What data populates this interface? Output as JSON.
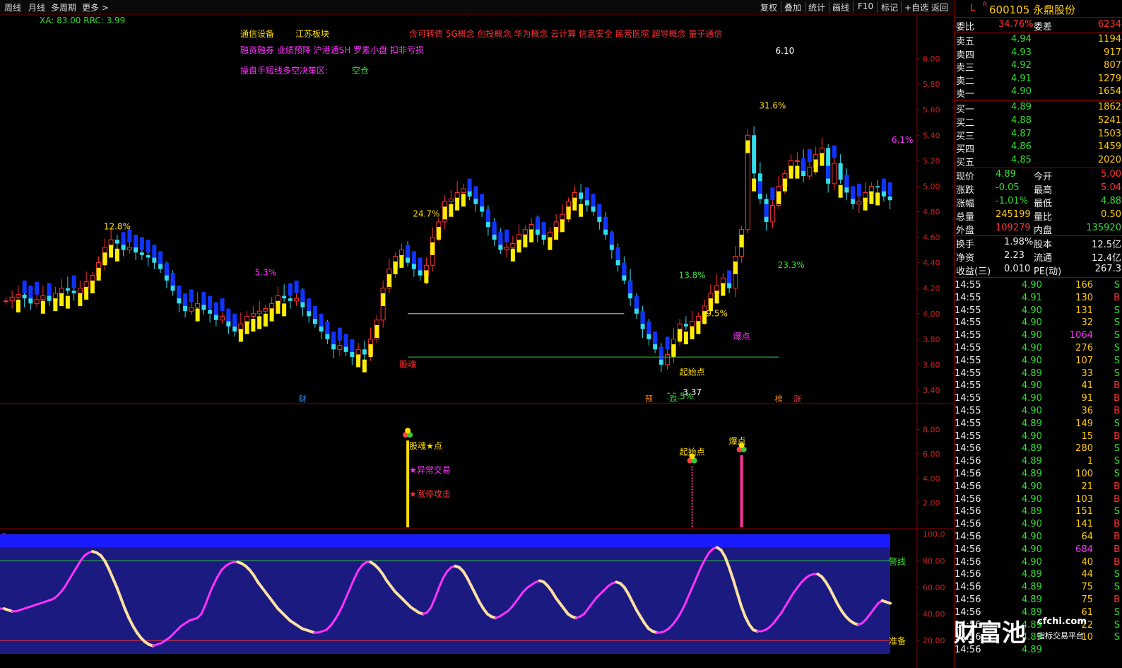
{
  "toolbar": {
    "left": [
      "周线",
      "月线",
      "多周期",
      "更多 >"
    ],
    "right": [
      "复权",
      "叠加",
      "统计",
      "画线",
      "F10",
      "标记",
      "+自选",
      "返回"
    ]
  },
  "stock": {
    "flag": "L",
    "flag_sup": "R",
    "code_name": "600105 永鼎股份"
  },
  "quote": {
    "ratio": {
      "label": "委比",
      "value": "34.76%",
      "label2": "委差",
      "value2": "6234"
    },
    "asks": [
      {
        "label": "卖五",
        "price": "4.94",
        "vol": "1194"
      },
      {
        "label": "卖四",
        "price": "4.93",
        "vol": "917"
      },
      {
        "label": "卖三",
        "price": "4.92",
        "vol": "807"
      },
      {
        "label": "卖二",
        "price": "4.91",
        "vol": "1279"
      },
      {
        "label": "卖一",
        "price": "4.90",
        "vol": "1654"
      }
    ],
    "bids": [
      {
        "label": "买一",
        "price": "4.89",
        "vol": "1862"
      },
      {
        "label": "买二",
        "price": "4.88",
        "vol": "5241"
      },
      {
        "label": "买三",
        "price": "4.87",
        "vol": "1503"
      },
      {
        "label": "买四",
        "price": "4.86",
        "vol": "1459"
      },
      {
        "label": "买五",
        "price": "4.85",
        "vol": "2020"
      }
    ],
    "stats": [
      {
        "l1": "现价",
        "v1": "4.89",
        "c1": "green",
        "l2": "今开",
        "v2": "5.00",
        "c2": "red"
      },
      {
        "l1": "涨跌",
        "v1": "-0.05",
        "c1": "green",
        "l2": "最高",
        "v2": "5.04",
        "c2": "red"
      },
      {
        "l1": "涨幅",
        "v1": "-1.01%",
        "c1": "green",
        "l2": "最低",
        "v2": "4.88",
        "c2": "green"
      },
      {
        "l1": "总量",
        "v1": "245199",
        "c1": "yellow",
        "l2": "量比",
        "v2": "0.50",
        "c2": "yellow"
      },
      {
        "l1": "外盘",
        "v1": "109279",
        "c1": "red",
        "l2": "内盘",
        "v2": "135920",
        "c2": "green"
      }
    ],
    "stats2": [
      {
        "l1": "换手",
        "v1": "1.98%",
        "l2": "股本",
        "v2": "12.5亿"
      },
      {
        "l1": "净资",
        "v1": "2.23",
        "l2": "流通",
        "v2": "12.4亿"
      },
      {
        "l1": "收益(三)",
        "v1": "0.010",
        "l2": "PE(动)",
        "v2": "267.3"
      }
    ]
  },
  "ticks": [
    {
      "t": "14:55",
      "p": "4.90",
      "v": "166",
      "s": "S"
    },
    {
      "t": "14:55",
      "p": "4.91",
      "v": "130",
      "s": "B"
    },
    {
      "t": "14:55",
      "p": "4.90",
      "v": "131",
      "s": "S"
    },
    {
      "t": "14:55",
      "p": "4.90",
      "v": "32",
      "s": "S"
    },
    {
      "t": "14:55",
      "p": "4.90",
      "v": "1064",
      "s": "S"
    },
    {
      "t": "14:55",
      "p": "4.90",
      "v": "276",
      "s": "S"
    },
    {
      "t": "14:55",
      "p": "4.90",
      "v": "107",
      "s": "S"
    },
    {
      "t": "14:55",
      "p": "4.89",
      "v": "33",
      "s": "S"
    },
    {
      "t": "14:55",
      "p": "4.90",
      "v": "41",
      "s": "B"
    },
    {
      "t": "14:55",
      "p": "4.90",
      "v": "91",
      "s": "B"
    },
    {
      "t": "14:55",
      "p": "4.90",
      "v": "36",
      "s": "B"
    },
    {
      "t": "14:55",
      "p": "4.89",
      "v": "149",
      "s": "S"
    },
    {
      "t": "14:55",
      "p": "4.90",
      "v": "15",
      "s": "B"
    },
    {
      "t": "14:56",
      "p": "4.89",
      "v": "280",
      "s": "S"
    },
    {
      "t": "14:56",
      "p": "4.89",
      "v": "1",
      "s": "S"
    },
    {
      "t": "14:56",
      "p": "4.89",
      "v": "100",
      "s": "S"
    },
    {
      "t": "14:56",
      "p": "4.90",
      "v": "21",
      "s": "B"
    },
    {
      "t": "14:56",
      "p": "4.90",
      "v": "103",
      "s": "B"
    },
    {
      "t": "14:56",
      "p": "4.89",
      "v": "151",
      "s": "S"
    },
    {
      "t": "14:56",
      "p": "4.90",
      "v": "141",
      "s": "B"
    },
    {
      "t": "14:56",
      "p": "4.90",
      "v": "64",
      "s": "B"
    },
    {
      "t": "14:56",
      "p": "4.90",
      "v": "684",
      "s": "B"
    },
    {
      "t": "14:56",
      "p": "4.90",
      "v": "40",
      "s": "B"
    },
    {
      "t": "14:56",
      "p": "4.89",
      "v": "44",
      "s": "S"
    },
    {
      "t": "14:56",
      "p": "4.89",
      "v": "75",
      "s": "S"
    },
    {
      "t": "14:56",
      "p": "4.89",
      "v": "75",
      "s": "B"
    },
    {
      "t": "14:56",
      "p": "4.89",
      "v": "61",
      "s": "S"
    },
    {
      "t": "14:56",
      "p": "4.89",
      "v": "22",
      "s": "S"
    },
    {
      "t": "14:56",
      "p": "4.89",
      "v": "10",
      "s": "S"
    },
    {
      "t": "14:56",
      "p": "4.89",
      "v": "",
      "s": ""
    }
  ],
  "watermark": {
    "big": "财富池",
    "url": "cfchi.com",
    "sub": "指标交易平台"
  },
  "chart_data": [
    {
      "type": "candlestick",
      "panel": "main",
      "info": "XA: 83.00  RRC: 3.99",
      "tags_line1": {
        "industry": "通信设备",
        "region": "江苏板块",
        "concepts": "含可转债 5G概念 创投概念 华为概念 云计算 信息安全 民营医院 超导概念 量子通信"
      },
      "tags_line2": "融资融券 业绩预降 沪港通SH 罗素小盘 扣非亏损",
      "strategy": {
        "label": "操盘手短线多空决策区:",
        "value": "空仓"
      },
      "y_ticks": [
        "6.00",
        "5.80",
        "5.60",
        "5.40",
        "5.20",
        "5.00",
        "4.80",
        "4.60",
        "4.40",
        "4.20",
        "4.00",
        "3.80",
        "3.60",
        "3.40"
      ],
      "ylim": [
        3.3,
        6.25
      ],
      "close": [
        4.1,
        4.13,
        4.15,
        4.12,
        4.08,
        4.11,
        4.14,
        4.1,
        4.16,
        4.2,
        4.18,
        4.16,
        4.2,
        4.25,
        4.3,
        4.4,
        4.52,
        4.58,
        4.55,
        4.5,
        4.52,
        4.48,
        4.46,
        4.44,
        4.4,
        4.35,
        4.26,
        4.18,
        4.08,
        4.02,
        4.05,
        4.08,
        4.03,
        4.0,
        3.95,
        3.98,
        3.9,
        3.86,
        3.92,
        3.98,
        4.0,
        4.02,
        4.04,
        4.08,
        4.14,
        4.12,
        4.1,
        4.12,
        4.05,
        3.98,
        3.92,
        3.86,
        3.8,
        3.72,
        3.75,
        3.7,
        3.66,
        3.72,
        3.68,
        3.8,
        3.95,
        4.2,
        4.35,
        4.45,
        4.5,
        4.4,
        4.35,
        4.3,
        4.38,
        4.6,
        4.72,
        4.88,
        4.9,
        4.95,
        4.98,
        4.92,
        4.86,
        4.8,
        4.68,
        4.58,
        4.5,
        4.52,
        4.55,
        4.62,
        4.66,
        4.7,
        4.62,
        4.58,
        4.64,
        4.72,
        4.78,
        4.88,
        4.95,
        4.9,
        4.85,
        4.8,
        4.72,
        4.62,
        4.5,
        4.38,
        4.26,
        4.12,
        4.0,
        3.88,
        3.8,
        3.72,
        3.6,
        3.68,
        3.8,
        3.92,
        3.9,
        3.94,
        3.98,
        4.06,
        4.16,
        4.22,
        4.28,
        4.2,
        4.45,
        4.66,
        5.4,
        5.1,
        4.9,
        4.72,
        4.85,
        5.0,
        5.1,
        5.2,
        5.2,
        5.08,
        5.15,
        5.25,
        5.3,
        5.02,
        5.18,
        5.05,
        4.95,
        4.86,
        4.88,
        4.95,
        5.0,
        4.99,
        4.92,
        4.89
      ],
      "annotations": [
        {
          "text": "12.8%",
          "x": 18,
          "y": 4.66,
          "color": "yellow"
        },
        {
          "text": "5.3%",
          "x": 42,
          "y": 4.3,
          "color": "magenta"
        },
        {
          "text": "24.7%",
          "x": 68,
          "y": 4.76,
          "color": "yellow"
        },
        {
          "text": "13.8%",
          "x": 111,
          "y": 4.28,
          "color": "green"
        },
        {
          "text": "9.5%",
          "x": 115,
          "y": 3.98,
          "color": "yellow"
        },
        {
          "text": "31.6%",
          "x": 124,
          "y": 5.61,
          "color": "yellow"
        },
        {
          "text": "23.3%",
          "x": 127,
          "y": 4.36,
          "color": "green"
        },
        {
          "text": "6.1%",
          "x": 145,
          "y": 5.34,
          "color": "magenta"
        },
        {
          "text": "股魂",
          "x": 65,
          "y": 3.58,
          "color": "red"
        },
        {
          "text": "起始点",
          "x": 111,
          "y": 3.52,
          "color": "yellow"
        },
        {
          "text": "爆点",
          "x": 119,
          "y": 3.8,
          "color": "magenta"
        },
        {
          "text": "6.10",
          "x": 126,
          "y": 6.04,
          "color": "white"
        },
        {
          "text": "3.37",
          "x": 111,
          "y": 3.36,
          "color": "white"
        },
        {
          "text": "19.5%",
          "x": 109,
          "y": 3.33,
          "color": "green"
        }
      ],
      "hlines": [
        {
          "y": 4.0,
          "x0": 65,
          "x1": 100,
          "color": "#e0d060"
        },
        {
          "y": 3.66,
          "x0": 65,
          "x1": 125,
          "color": "#33cc33"
        }
      ],
      "event_markers": [
        {
          "text": "财",
          "x": 48,
          "color": "#3399ff"
        },
        {
          "text": "预",
          "x": 104,
          "color": "#ff8800"
        },
        {
          "text": "跌",
          "x": 108,
          "color": "#33cc33"
        },
        {
          "text": "榜",
          "x": 125,
          "color": "#ff8800"
        },
        {
          "text": "涨",
          "x": 128,
          "color": "#ff3333"
        }
      ]
    },
    {
      "type": "signal-bars",
      "panel": "signal",
      "y_ticks": [
        "8.00",
        "6.00",
        "4.00",
        "2.00"
      ],
      "ylim": [
        0,
        10
      ],
      "signals": [
        {
          "x": 65,
          "value": 7.1,
          "color": "#ffdd00",
          "labels": [
            "股魂★点",
            "★异常交易",
            "★涨停攻击"
          ]
        },
        {
          "x": 111,
          "value": 5.0,
          "color": "#ff3399",
          "labels": [
            "起始点"
          ],
          "dotted": true
        },
        {
          "x": 119,
          "value": 5.9,
          "color": "#ff3399",
          "labels": [
            "爆点"
          ]
        }
      ]
    },
    {
      "type": "line",
      "panel": "oscillator",
      "zero_label": "0",
      "y_ticks": [
        "100.0",
        "80.00",
        "60.00",
        "40.00",
        "20.00"
      ],
      "ylim": [
        10,
        103
      ],
      "bands": [
        {
          "y0": 90,
          "y1": 100,
          "color": "#1a1aff"
        },
        {
          "y0": 10,
          "y1": 90,
          "color": "#1a1a80"
        }
      ],
      "lines": [
        {
          "name": "警线",
          "y": 80,
          "color": "#33cc33"
        },
        {
          "name": "准备",
          "y": 20,
          "color": "#ff3333"
        }
      ],
      "series_rising_color": "#ff33ff",
      "series_falling_color": "#ffe0a0",
      "values": [
        44,
        44,
        43,
        42,
        42,
        43,
        44,
        45,
        46,
        47,
        48,
        49,
        50,
        51,
        53,
        56,
        60,
        65,
        70,
        75,
        80,
        84,
        86,
        87,
        86,
        84,
        80,
        74,
        67,
        60,
        52,
        44,
        37,
        31,
        26,
        22,
        19,
        17,
        16,
        17,
        18,
        20,
        22,
        25,
        28,
        31,
        33,
        35,
        36,
        37,
        40,
        47,
        55,
        62,
        68,
        73,
        76,
        78,
        79,
        79,
        78,
        76,
        73,
        69,
        64,
        60,
        56,
        52,
        48,
        44,
        41,
        38,
        35,
        33,
        31,
        29,
        28,
        27,
        26,
        26,
        27,
        28,
        31,
        35,
        40,
        46,
        53,
        60,
        67,
        73,
        77,
        79,
        79,
        77,
        74,
        70,
        65,
        61,
        57,
        54,
        51,
        48,
        45,
        43,
        41,
        40,
        41,
        45,
        52,
        60,
        67,
        72,
        75,
        76,
        75,
        72,
        67,
        61,
        55,
        49,
        44,
        40,
        38,
        37,
        38,
        40,
        42,
        45,
        49,
        53,
        57,
        60,
        62,
        64,
        65,
        64,
        61,
        57,
        52,
        48,
        44,
        40,
        38,
        37,
        38,
        40,
        44,
        48,
        52,
        55,
        58,
        61,
        63,
        64,
        63,
        60,
        55,
        49,
        43,
        38,
        33,
        29,
        27,
        26,
        26,
        27,
        29,
        32,
        36,
        41,
        47,
        54,
        61,
        68,
        75,
        81,
        86,
        89,
        90,
        88,
        83,
        75,
        66,
        56,
        46,
        38,
        32,
        28,
        27,
        27,
        28,
        30,
        33,
        37,
        41,
        46,
        51,
        56,
        60,
        64,
        67,
        69,
        70,
        70,
        68,
        64,
        59,
        53,
        47,
        42,
        38,
        35,
        33,
        32,
        33,
        36,
        40,
        44,
        48,
        50,
        49,
        48
      ]
    }
  ]
}
